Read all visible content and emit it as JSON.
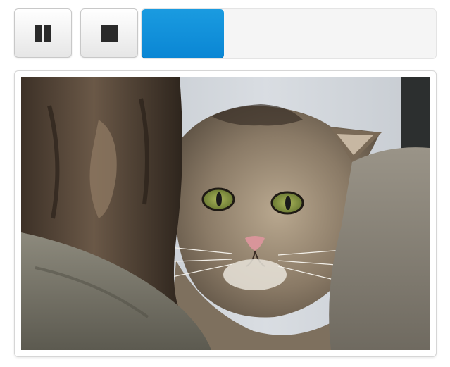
{
  "player": {
    "pause_icon": "pause-icon",
    "stop_icon": "stop-icon",
    "progress_percent": 28,
    "accent_color": "#0a86d4"
  },
  "photo": {
    "subject_icon": "wildcat-photo"
  }
}
